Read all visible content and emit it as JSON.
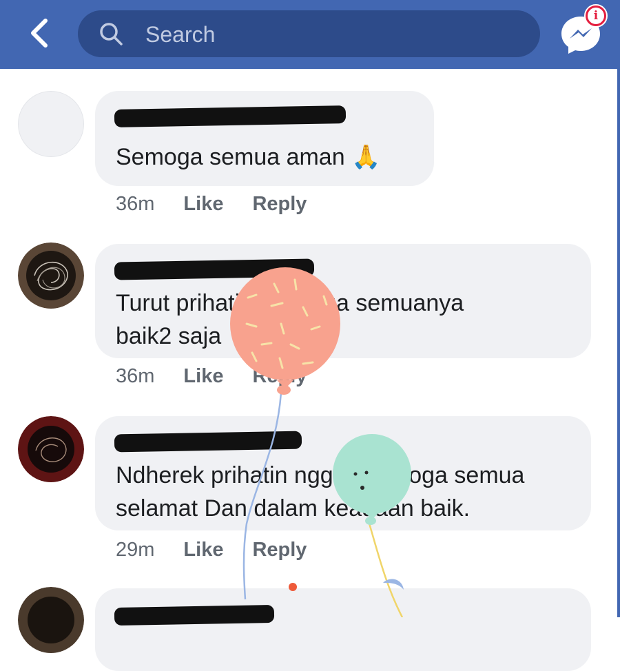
{
  "header": {
    "search_placeholder": "Search",
    "notification_badge": "i",
    "colors": {
      "bar": "#4267b2",
      "search_field": "#2d4b8a",
      "badge": "#e41e3f"
    }
  },
  "comments": [
    {
      "text": "Semoga semua aman 🙏",
      "time": "36m",
      "like_label": "Like",
      "reply_label": "Reply"
    },
    {
      "text": "Turut prihatin, semoga semuanya\nbaik2 saja",
      "time": "36m",
      "like_label": "Like",
      "reply_label": "Reply"
    },
    {
      "text": "Ndherek prihatin nggih, semoga semua\nselamat Dan dalam keadaan baik.",
      "time": "29m",
      "like_label": "Like",
      "reply_label": "Reply"
    }
  ],
  "icons": [
    "back-icon",
    "search-icon",
    "messenger-icon",
    "info-badge-icon",
    "balloon-decoration"
  ]
}
